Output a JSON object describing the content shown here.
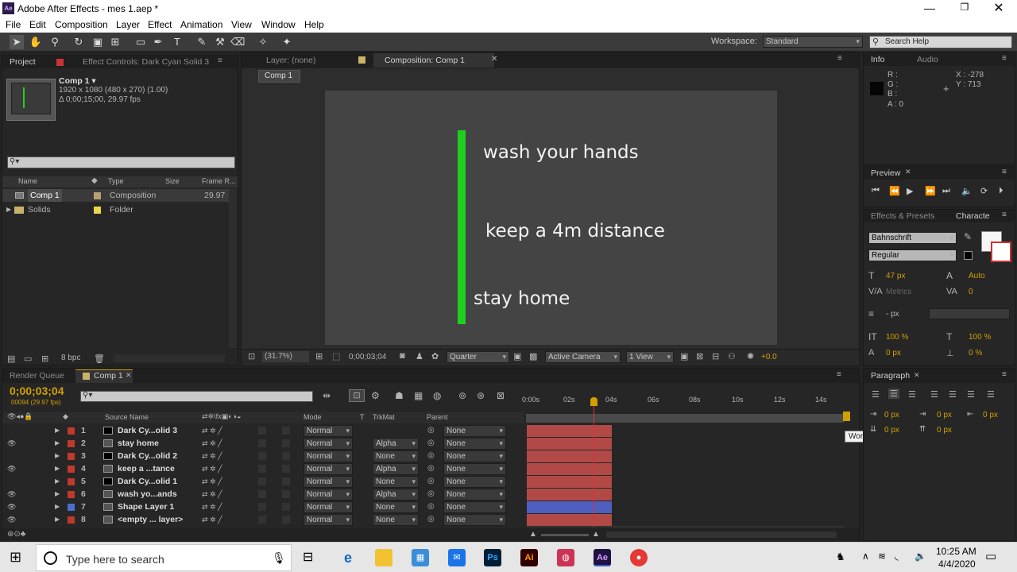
{
  "window": {
    "title": "Adobe After Effects - mes 1.aep *",
    "app_icon": "Ae"
  },
  "menu": [
    "File",
    "Edit",
    "Composition",
    "Layer",
    "Effect",
    "Animation",
    "View",
    "Window",
    "Help"
  ],
  "toolbar": {
    "workspace_label": "Workspace:",
    "workspace_value": "Standard",
    "search_placeholder": "Search Help"
  },
  "project": {
    "tab": "Project",
    "effect_tab": "Effect Controls: Dark Cyan Solid 3",
    "comp_name": "Comp 1 ▾",
    "comp_info1": "1920 x 1080  (480 x 270) (1.00)",
    "comp_info2": "Δ 0;00;15;00, 29.97 fps",
    "columns": {
      "name": "Name",
      "type": "Type",
      "size": "Size",
      "frame": "Frame R..."
    },
    "items": [
      {
        "name": "Comp 1",
        "type": "Composition",
        "frame": "29.97",
        "color": "#b8a073"
      },
      {
        "name": "Solids",
        "type": "Folder",
        "frame": "",
        "color": "#e8d84a"
      }
    ],
    "bpc": "8 bpc"
  },
  "viewer": {
    "layer_tab": "Layer: (none)",
    "comp_tab": "Composition: Comp 1",
    "crumb": "Comp 1",
    "texts": [
      "wash your hands",
      "keep a 4m distance",
      "stay home"
    ],
    "bar_color": "#1fcf1f",
    "zoom": "(31.7%)",
    "timecode": "0;00;03;04",
    "resolution": "Quarter",
    "camera": "Active Camera",
    "view": "1 View",
    "exposure": "+0.0"
  },
  "info": {
    "tab": "Info",
    "tab2": "Audio",
    "labels": [
      "R :",
      "G :",
      "B :",
      "A : 0"
    ],
    "x": "X : -278",
    "y": "Y : 713"
  },
  "preview": {
    "tab": "Preview"
  },
  "character": {
    "effects_tab": "Effects & Presets",
    "tab": "Characte",
    "font": "Bahnschrift",
    "style": "Regular",
    "size": "47 px",
    "leading": "Auto",
    "kerning": "Metrics",
    "tracking": "0",
    "stroke": "- px",
    "vscale": "100 %",
    "hscale": "100 %",
    "baseline": "0 px",
    "tsume": "0 %"
  },
  "paragraph": {
    "tab": "Paragraph",
    "v1": "0 px",
    "v2": "0 px",
    "v3": "0 px",
    "v4": "0 px",
    "v5": "0 px"
  },
  "timeline": {
    "render_tab": "Render Queue",
    "comp_tab": "Comp 1",
    "timecode": "0;00;03;04",
    "frames": "00094 (29.97 fps)",
    "cols": {
      "source": "Source Name",
      "mode": "Mode",
      "t": "T",
      "trkmat": "TrkMat",
      "parent": "Parent"
    },
    "ruler": [
      "0:00s",
      "02s",
      "04s",
      "06s",
      "08s",
      "10s",
      "12s",
      "14s"
    ],
    "tooltip": "Work Area End",
    "layers": [
      {
        "num": "1",
        "name": "Dark Cy...olid 3",
        "color": "#c0392b",
        "mode": "Normal",
        "trk": "",
        "parent": "None",
        "bar": "#b14a47"
      },
      {
        "num": "2",
        "name": "stay home",
        "color": "#c0392b",
        "mode": "Normal",
        "trk": "Alpha",
        "parent": "None",
        "bar": "#b14a47"
      },
      {
        "num": "3",
        "name": "Dark Cy...olid 2",
        "color": "#c0392b",
        "mode": "Normal",
        "trk": "None",
        "parent": "None",
        "bar": "#b14a47"
      },
      {
        "num": "4",
        "name": "keep a ...tance",
        "color": "#c0392b",
        "mode": "Normal",
        "trk": "Alpha",
        "parent": "None",
        "bar": "#b14a47"
      },
      {
        "num": "5",
        "name": "Dark Cy...olid 1",
        "color": "#c0392b",
        "mode": "Normal",
        "trk": "None",
        "parent": "None",
        "bar": "#b14a47"
      },
      {
        "num": "6",
        "name": "wash yo...ands",
        "color": "#c0392b",
        "mode": "Normal",
        "trk": "Alpha",
        "parent": "None",
        "bar": "#b14a47"
      },
      {
        "num": "7",
        "name": "Shape Layer 1",
        "color": "#4b6fd1",
        "mode": "Normal",
        "trk": "None",
        "parent": "None",
        "bar": "#4e5fbf"
      },
      {
        "num": "8",
        "name": "<empty ... layer>",
        "color": "#c0392b",
        "mode": "Normal",
        "trk": "None",
        "parent": "None",
        "bar": "#b14a47"
      }
    ]
  },
  "taskbar": {
    "search": "Type here to search",
    "time": "10:25 AM",
    "date": "4/4/2020"
  }
}
